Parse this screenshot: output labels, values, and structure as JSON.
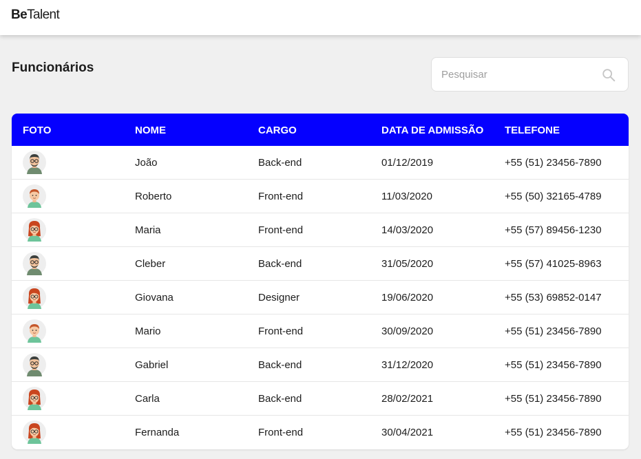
{
  "header": {
    "logo_bold": "Be",
    "logo_regular": "Talent"
  },
  "page": {
    "title": "Funcionários"
  },
  "search": {
    "placeholder": "Pesquisar",
    "value": "",
    "icon": "search-icon"
  },
  "colors": {
    "header_bg": "#0500ff",
    "page_bg": "#f0f0f0",
    "text": "#1c1c1c"
  },
  "table": {
    "columns": [
      "Foto",
      "Nome",
      "Cargo",
      "Data de admissão",
      "Telefone"
    ],
    "rows": [
      {
        "avatar": "man-glasses",
        "name": "João",
        "role": "Back-end",
        "admission": "01/12/2019",
        "phone": "+55 (51) 23456-7890"
      },
      {
        "avatar": "boy",
        "name": "Roberto",
        "role": "Front-end",
        "admission": "11/03/2020",
        "phone": "+55 (50) 32165-4789"
      },
      {
        "avatar": "woman",
        "name": "Maria",
        "role": "Front-end",
        "admission": "14/03/2020",
        "phone": "+55 (57) 89456-1230"
      },
      {
        "avatar": "man-glasses",
        "name": "Cleber",
        "role": "Back-end",
        "admission": "31/05/2020",
        "phone": "+55 (57) 41025-8963"
      },
      {
        "avatar": "woman",
        "name": "Giovana",
        "role": "Designer",
        "admission": "19/06/2020",
        "phone": "+55 (53) 69852-0147"
      },
      {
        "avatar": "boy",
        "name": "Mario",
        "role": "Front-end",
        "admission": "30/09/2020",
        "phone": "+55 (51) 23456-7890"
      },
      {
        "avatar": "man-glasses",
        "name": "Gabriel",
        "role": "Back-end",
        "admission": "31/12/2020",
        "phone": "+55 (51) 23456-7890"
      },
      {
        "avatar": "woman",
        "name": "Carla",
        "role": "Back-end",
        "admission": "28/02/2021",
        "phone": "+55 (51) 23456-7890"
      },
      {
        "avatar": "woman",
        "name": "Fernanda",
        "role": "Front-end",
        "admission": "30/04/2021",
        "phone": "+55 (51) 23456-7890"
      }
    ]
  }
}
